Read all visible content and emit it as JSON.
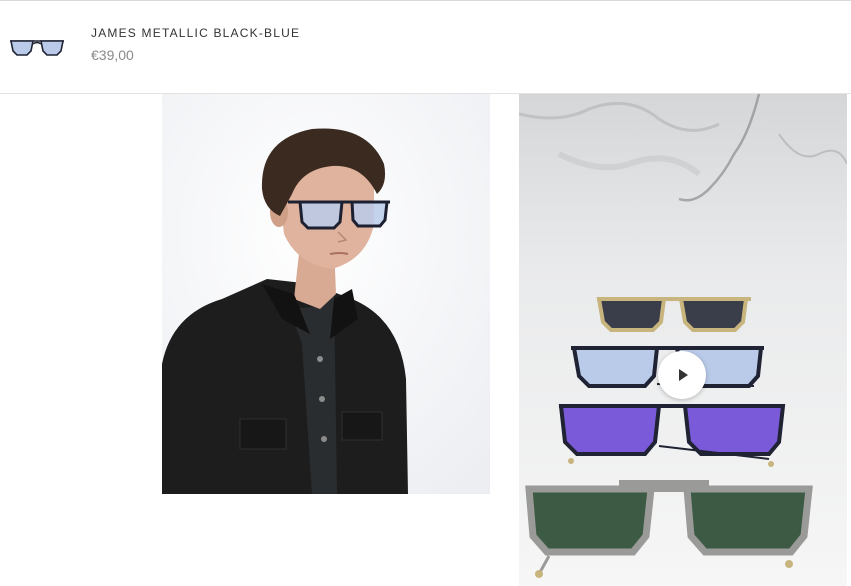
{
  "product": {
    "name": "JAMES METALLIC BLACK-BLUE",
    "price": "€39,00",
    "thumbnail_icon": "sunglasses-thumbnail"
  },
  "gallery": {
    "images": [
      {
        "subject": "model-wearing-sunglasses"
      },
      {
        "subject": "sunglasses-flatlay-marble",
        "has_video": true
      }
    ],
    "play_icon": "play-icon"
  },
  "colors": {
    "text_dark": "#333333",
    "text_muted": "#8a8a8a",
    "border": "#e3e3e3",
    "lens_blue": "#b9cbe9",
    "lens_purple": "#7a5ad8",
    "lens_green": "#3c5a44",
    "frame_gold": "#c8b57e",
    "frame_silver": "#9a9a98"
  }
}
